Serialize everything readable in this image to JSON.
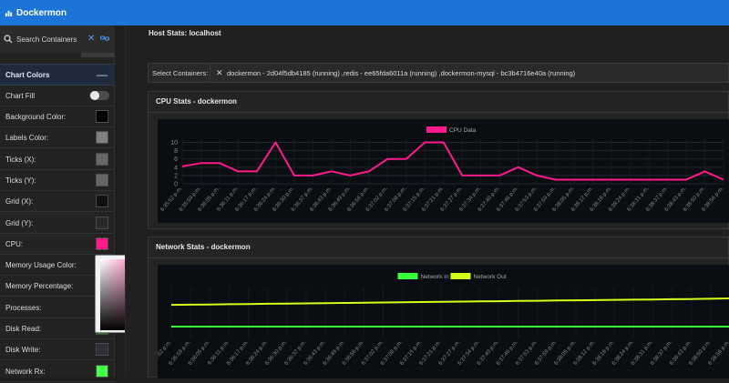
{
  "app": {
    "title": "Dockermon"
  },
  "search": {
    "placeholder": "Search Containers"
  },
  "sidebar": {
    "section_title": "Chart Colors",
    "chart_fill_label": "Chart Fill",
    "items": [
      {
        "label": "Background Color:",
        "color": "#000000"
      },
      {
        "label": "Labels Color:",
        "color": "#808080"
      },
      {
        "label": "Ticks (X):",
        "color": "#666666"
      },
      {
        "label": "Ticks (Y):",
        "color": "#666666"
      },
      {
        "label": "Grid (X):",
        "color": "#111111"
      },
      {
        "label": "Grid (Y):",
        "color": "#2a2a2a"
      },
      {
        "label": "CPU:",
        "color": "#ff1a8c"
      },
      {
        "label": "Memory Usage Color:",
        "color": "#ff1a8c"
      },
      {
        "label": "Memory Percentage:",
        "color": "#ff1a8c"
      },
      {
        "label": "Processes:",
        "color": "#ff1a8c"
      },
      {
        "label": "Disk Read:",
        "color": "#1a7a2a"
      },
      {
        "label": "Disk Write:",
        "color": "#2b2f3a"
      },
      {
        "label": "Network Rx:",
        "color": "#44ff44"
      }
    ]
  },
  "main": {
    "host_title": "Host Stats: localhost",
    "select_label": "Select Containers:",
    "selected_containers": "dockermon - 2d04f5db4185 (running) ,redis - ee65fda6011a (running) ,dockermon-mysql - bc3b4716e40a (running)",
    "cpu_title": "CPU Stats - dockermon",
    "network_title": "Network Stats - dockermon"
  },
  "colors": {
    "accent": "#1b74d6",
    "cpu": "#ff1a8c",
    "net_in": "#39ff39",
    "net_out": "#d4ff1a"
  },
  "chart_data": [
    {
      "type": "line",
      "title": "",
      "series": [
        {
          "name": "CPU Data",
          "color": "#ff1a8c",
          "values": [
            4.2,
            5,
            5,
            3,
            3,
            10,
            2,
            2,
            3,
            2,
            3,
            6,
            6,
            10,
            10,
            2,
            2,
            2,
            4,
            2,
            1,
            1,
            1,
            1,
            1,
            1,
            1,
            1,
            3,
            1
          ]
        }
      ],
      "x": [
        "6:35:52 p.m.",
        "6:35:59 p.m.",
        "6:36:05 p.m.",
        "6:36:11 p.m.",
        "6:36:17 p.m.",
        "6:36:24 p.m.",
        "6:36:30 p.m.",
        "6:36:37 p.m.",
        "6:36:43 p.m.",
        "6:36:49 p.m.",
        "6:36:56 p.m.",
        "6:37:02 p.m.",
        "6:37:08 p.m.",
        "6:37:15 p.m.",
        "6:37:21 p.m.",
        "6:37:27 p.m.",
        "6:37:34 p.m.",
        "6:37:40 p.m.",
        "6:37:46 p.m.",
        "6:37:53 p.m.",
        "6:37:59 p.m.",
        "6:38:05 p.m.",
        "6:38:12 p.m.",
        "6:38:18 p.m.",
        "6:38:24 p.m.",
        "6:38:31 p.m.",
        "6:38:37 p.m.",
        "6:38:43 p.m.",
        "6:38:50 p.m.",
        "6:38:56 p.m."
      ],
      "yticks": [
        0,
        2,
        4,
        6,
        8,
        10
      ],
      "ylim": [
        0,
        11
      ]
    },
    {
      "type": "line",
      "title": "",
      "series": [
        {
          "name": "Network In",
          "color": "#39ff39",
          "values": [
            0,
            0,
            0,
            0,
            0,
            0,
            0,
            0,
            0,
            0,
            0,
            0,
            0,
            0,
            0,
            0,
            0,
            0,
            0,
            0,
            0,
            0,
            0,
            0,
            0,
            0,
            0,
            0,
            0,
            0
          ]
        },
        {
          "name": "Network Out",
          "color": "#d4ff1a",
          "values": [
            1.0,
            1.01,
            1.02,
            1.03,
            1.04,
            1.05,
            1.06,
            1.07,
            1.08,
            1.09,
            1.1,
            1.11,
            1.12,
            1.13,
            1.14,
            1.15,
            1.16,
            1.17,
            1.18,
            1.19,
            1.2,
            1.21,
            1.22,
            1.23,
            1.24,
            1.25,
            1.26,
            1.27,
            1.28,
            1.3
          ]
        }
      ],
      "x": [
        "6:35:52 p.m.",
        "6:35:59 p.m.",
        "6:36:05 p.m.",
        "6:36:11 p.m.",
        "6:36:17 p.m.",
        "6:36:24 p.m.",
        "6:36:30 p.m.",
        "6:36:37 p.m.",
        "6:36:43 p.m.",
        "6:36:49 p.m.",
        "6:36:56 p.m.",
        "6:37:02 p.m.",
        "6:37:08 p.m.",
        "6:37:15 p.m.",
        "6:37:21 p.m.",
        "6:37:27 p.m.",
        "6:37:34 p.m.",
        "6:37:40 p.m.",
        "6:37:46 p.m.",
        "6:37:53 p.m.",
        "6:37:59 p.m.",
        "6:38:05 p.m.",
        "6:38:12 p.m.",
        "6:38:18 p.m.",
        "6:38:24 p.m.",
        "6:38:31 p.m.",
        "6:38:37 p.m.",
        "6:38:43 p.m.",
        "6:38:50 p.m.",
        "6:38:56 p.m."
      ],
      "ylim": [
        -0.5,
        1.8
      ]
    }
  ]
}
